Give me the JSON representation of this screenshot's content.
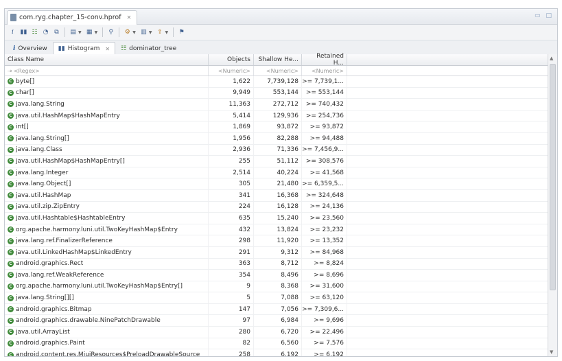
{
  "editor_tab": {
    "title": "com.ryg.chapter_15-conv.hprof"
  },
  "toolbar": {
    "icons": [
      "info-icon",
      "histogram-icon",
      "dominator-tree-icon",
      "top-consumers-icon",
      "duplicate-classes-icon",
      "query-browser-icon",
      "sql-icon",
      "search-icon",
      "calculate-icon",
      "group-by-icon",
      "export-icon",
      "filter-icon",
      "pin-icon"
    ]
  },
  "tabs": [
    {
      "label": "Overview"
    },
    {
      "label": "Histogram"
    },
    {
      "label": "dominator_tree"
    }
  ],
  "table": {
    "headers": [
      "Class Name",
      "Objects",
      "Shallow He...",
      "Retained H..."
    ],
    "filters": [
      "<Regex>",
      "<Numeric>",
      "<Numeric>",
      "<Numeric>"
    ],
    "rows": [
      {
        "name": "byte[]",
        "objects": "1,622",
        "shallow": "7,739,128",
        "retained": ">= 7,739,1..."
      },
      {
        "name": "char[]",
        "objects": "9,949",
        "shallow": "553,144",
        "retained": ">= 553,144"
      },
      {
        "name": "java.lang.String",
        "objects": "11,363",
        "shallow": "272,712",
        "retained": ">= 740,432"
      },
      {
        "name": "java.util.HashMap$HashMapEntry",
        "objects": "5,414",
        "shallow": "129,936",
        "retained": ">= 254,736"
      },
      {
        "name": "int[]",
        "objects": "1,869",
        "shallow": "93,872",
        "retained": ">= 93,872"
      },
      {
        "name": "java.lang.String[]",
        "objects": "1,956",
        "shallow": "82,288",
        "retained": ">= 94,488"
      },
      {
        "name": "java.lang.Class",
        "objects": "2,936",
        "shallow": "71,336",
        "retained": ">= 7,456,9..."
      },
      {
        "name": "java.util.HashMap$HashMapEntry[]",
        "objects": "255",
        "shallow": "51,112",
        "retained": ">= 308,576"
      },
      {
        "name": "java.lang.Integer",
        "objects": "2,514",
        "shallow": "40,224",
        "retained": ">= 41,568"
      },
      {
        "name": "java.lang.Object[]",
        "objects": "305",
        "shallow": "21,480",
        "retained": ">= 6,359,5..."
      },
      {
        "name": "java.util.HashMap",
        "objects": "341",
        "shallow": "16,368",
        "retained": ">= 324,648"
      },
      {
        "name": "java.util.zip.ZipEntry",
        "objects": "224",
        "shallow": "16,128",
        "retained": ">= 24,136"
      },
      {
        "name": "java.util.Hashtable$HashtableEntry",
        "objects": "635",
        "shallow": "15,240",
        "retained": ">= 23,560"
      },
      {
        "name": "org.apache.harmony.luni.util.TwoKeyHashMap$Entry",
        "objects": "432",
        "shallow": "13,824",
        "retained": ">= 23,232"
      },
      {
        "name": "java.lang.ref.FinalizerReference",
        "objects": "298",
        "shallow": "11,920",
        "retained": ">= 13,352"
      },
      {
        "name": "java.util.LinkedHashMap$LinkedEntry",
        "objects": "291",
        "shallow": "9,312",
        "retained": ">= 84,968"
      },
      {
        "name": "android.graphics.Rect",
        "objects": "363",
        "shallow": "8,712",
        "retained": ">= 8,824"
      },
      {
        "name": "java.lang.ref.WeakReference",
        "objects": "354",
        "shallow": "8,496",
        "retained": ">= 8,696"
      },
      {
        "name": "org.apache.harmony.luni.util.TwoKeyHashMap$Entry[]",
        "objects": "9",
        "shallow": "8,368",
        "retained": ">= 31,600"
      },
      {
        "name": "java.lang.String[][]",
        "objects": "5",
        "shallow": "7,088",
        "retained": ">= 63,120"
      },
      {
        "name": "android.graphics.Bitmap",
        "objects": "147",
        "shallow": "7,056",
        "retained": ">= 7,309,6..."
      },
      {
        "name": "android.graphics.drawable.NinePatchDrawable",
        "objects": "97",
        "shallow": "6,984",
        "retained": ">= 9,696"
      },
      {
        "name": "java.util.ArrayList",
        "objects": "280",
        "shallow": "6,720",
        "retained": ">= 22,496"
      },
      {
        "name": "android.graphics.Paint",
        "objects": "82",
        "shallow": "6,560",
        "retained": ">= 7,576"
      },
      {
        "name": "android.content.res.MiuiResources$PreloadDrawableSource",
        "objects": "258",
        "shallow": "6,192",
        "retained": ">= 6,192"
      }
    ]
  }
}
